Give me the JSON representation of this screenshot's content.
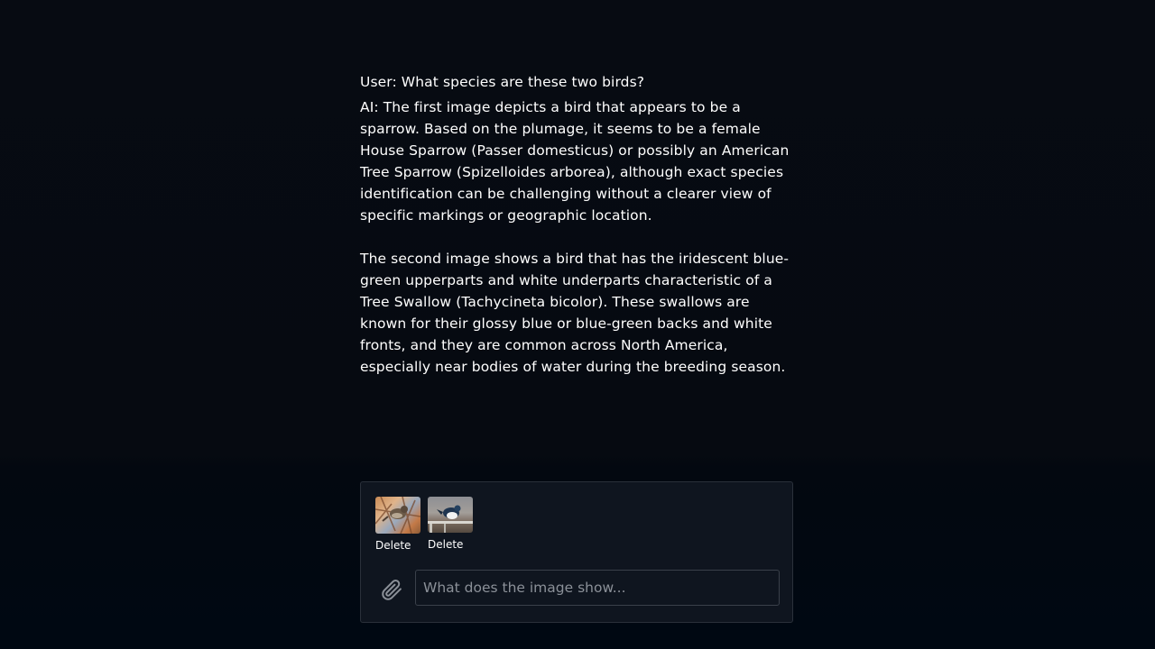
{
  "conversation": {
    "user_message": "User: What species are these two birds?",
    "ai_paragraphs": [
      "AI: The first image depicts a bird that appears to be a sparrow. Based on the plumage, it seems to be a female House Sparrow (Passer domesticus) or possibly an American Tree Sparrow (Spizelloides arborea), although exact species identification can be challenging without a clearer view of specific markings or geographic location.",
      "The second image shows a bird that has the iridescent blue-green upperparts and white underparts characteristic of a Tree Swallow (Tachycineta bicolor). These swallows are known for their glossy blue or blue-green backs and white fronts, and they are common across North America, especially near bodies of water during the breeding season."
    ]
  },
  "composer": {
    "attachments": [
      {
        "delete_label": "Delete",
        "icon": "sparrow-photo-thumbnail"
      },
      {
        "delete_label": "Delete",
        "icon": "swallow-photo-thumbnail"
      }
    ],
    "attach_icon": "paperclip-icon",
    "input_placeholder": "What does the image show...",
    "input_value": ""
  }
}
